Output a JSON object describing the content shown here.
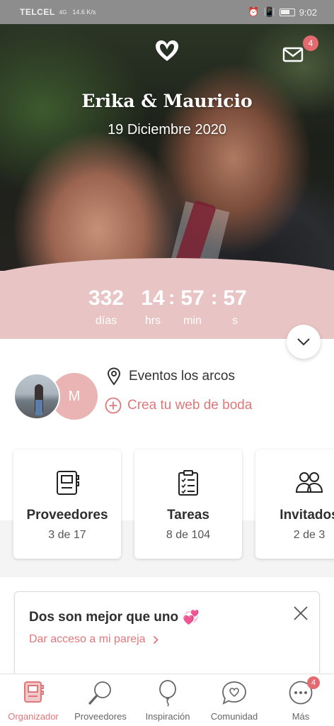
{
  "status_bar": {
    "carrier": "TELCEL",
    "signal": "4G",
    "speed": "14.6 K/s",
    "time": "9:02"
  },
  "hero": {
    "couple_names": "Erika & Mauricio",
    "wedding_date": "19 Diciembre 2020",
    "mail_badge": "4"
  },
  "countdown": {
    "days": "332",
    "days_label": "días",
    "hours": "14",
    "hours_label": "hrs",
    "minutes": "57",
    "minutes_label": "min",
    "seconds": "57",
    "seconds_label": "s",
    "separator": ":"
  },
  "profile": {
    "partner_initial": "M",
    "venue": "Eventos los arcos",
    "create_web_label": "Crea tu web de boda"
  },
  "cards": [
    {
      "title": "Proveedores",
      "progress": "3 de 17",
      "icon": "notebook-icon"
    },
    {
      "title": "Tareas",
      "progress": "8 de 104",
      "icon": "checklist-icon"
    },
    {
      "title": "Invitados",
      "progress": "2 de 3",
      "icon": "guests-icon"
    }
  ],
  "promo": {
    "title": "Dos son mejor que uno",
    "emoji": "💞",
    "link_label": "Dar acceso a mi pareja"
  },
  "bottom_nav": {
    "items": [
      {
        "label": "Organizador",
        "icon": "organizer-icon",
        "active": true
      },
      {
        "label": "Proveedores",
        "icon": "magnifier-icon"
      },
      {
        "label": "Inspiración",
        "icon": "balloon-icon"
      },
      {
        "label": "Comunidad",
        "icon": "chat-heart-icon"
      },
      {
        "label": "Más",
        "icon": "more-icon"
      }
    ],
    "more_badge": "4"
  },
  "colors": {
    "accent": "#e0777b",
    "countdown_bg": "#e8c4c5",
    "badge": "#e56a6f"
  }
}
